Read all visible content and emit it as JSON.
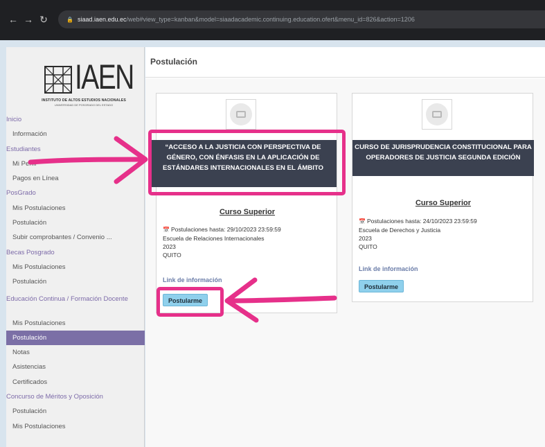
{
  "browser": {
    "url_host": "siaad.iaen.edu.ec",
    "url_path": "/web#view_type=kanban&model=siaadacademic.continuing.education.ofert&menu_id=826&action=1206"
  },
  "logo": {
    "text": "IAEN",
    "subtitle1": "INSTITUTO DE ALTOS ESTUDIOS NACIONALES",
    "subtitle2": "UNIVERSIDAD DE POSGRADO DEL ESTADO"
  },
  "sidebar": {
    "items": [
      {
        "label": "Inicio",
        "type": "section"
      },
      {
        "label": "Información",
        "type": "item"
      },
      {
        "label": "Estudiantes",
        "type": "section"
      },
      {
        "label": "Mi Perfil",
        "type": "item"
      },
      {
        "label": "Pagos en Línea",
        "type": "item"
      },
      {
        "label": "PosGrado",
        "type": "section"
      },
      {
        "label": "Mis Postulaciones",
        "type": "item"
      },
      {
        "label": "Postulación",
        "type": "item"
      },
      {
        "label": "Subir comprobantes / Convenio ...",
        "type": "item"
      },
      {
        "label": "Becas Posgrado",
        "type": "section"
      },
      {
        "label": "Mis Postulaciones",
        "type": "item"
      },
      {
        "label": "Postulación",
        "type": "item"
      },
      {
        "label": "Educación Continua / Formación Docente",
        "type": "section-two"
      },
      {
        "label": "Mis Postulaciones",
        "type": "item"
      },
      {
        "label": "Postulación",
        "type": "active"
      },
      {
        "label": "Notas",
        "type": "item"
      },
      {
        "label": "Asistencias",
        "type": "item"
      },
      {
        "label": "Certificados",
        "type": "item"
      },
      {
        "label": "Concurso de Méritos y Oposición",
        "type": "section"
      },
      {
        "label": "Postulación",
        "type": "item"
      },
      {
        "label": "Mis Postulaciones",
        "type": "item"
      }
    ]
  },
  "page": {
    "title": "Postulación"
  },
  "cards": [
    {
      "title": "“ACCESO A LA JUSTICIA CON PERSPECTIVA DE GÉNERO, CON ÉNFASIS EN LA APLICACIÓN DE ESTÁNDARES INTERNACIONALES EN EL ÁMBITO",
      "subtitle": "Curso Superior",
      "deadline": "Postulaciones hasta: 29/10/2023 23:59:59",
      "school": "Escuela de Relaciones Internacionales",
      "year": "2023",
      "city": "QUITO",
      "link": "Link de información",
      "button": "Postularme"
    },
    {
      "title": "CURSO DE JURISPRUDENCIA CONSTITUCIONAL PARA OPERADORES DE JUSTICIA SEGUNDA EDICIÓN",
      "subtitle": "Curso Superior",
      "deadline": "Postulaciones hasta: 24/10/2023 23:59:59",
      "school": "Escuela de Derechos y Justicia",
      "year": "2023",
      "city": "QUITO",
      "link": "Link de información",
      "button": "Postularme"
    }
  ],
  "colors": {
    "highlight": "#e6308a",
    "sidebar_active": "#7b6fa6",
    "button": "#8fd0ec",
    "title_box": "#3b4150"
  }
}
